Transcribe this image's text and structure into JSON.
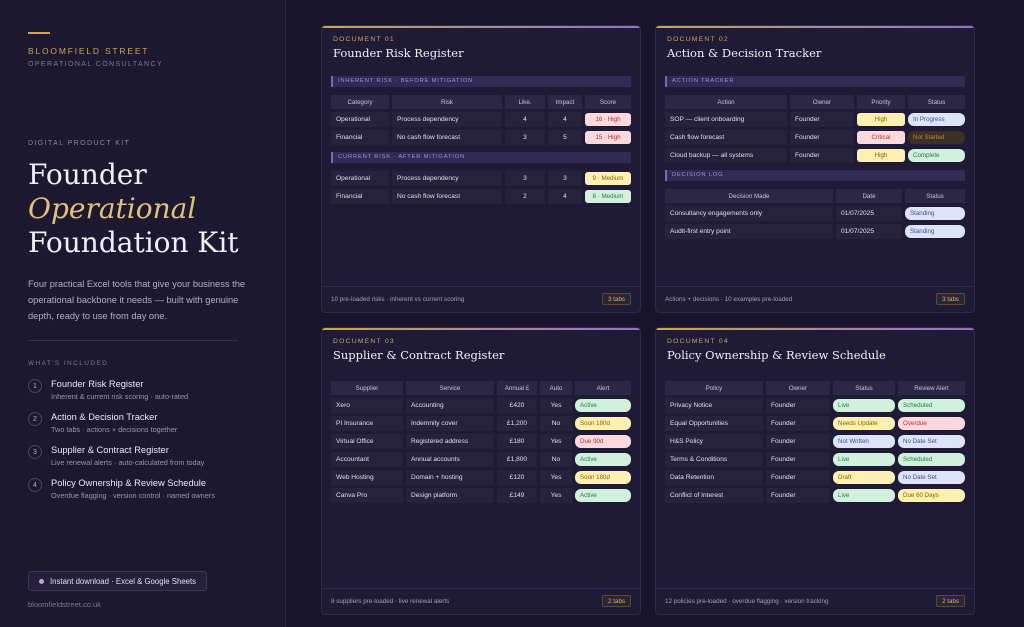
{
  "sidebar": {
    "brand": "BLOOMFIELD STREET",
    "brand_sub": "OPERATIONAL CONSULTANCY",
    "kit_label": "DIGITAL PRODUCT KIT",
    "title_line1": "Founder",
    "title_line2": "Operational",
    "title_line3": "Foundation Kit",
    "description": "Four practical Excel tools that give your business the operational backbone it needs — built with genuine depth, ready to use from day one.",
    "included_label": "WHAT'S INCLUDED",
    "items": [
      {
        "num": "1",
        "title": "Founder Risk Register",
        "sub": "Inherent & current risk scoring · auto-rated"
      },
      {
        "num": "2",
        "title": "Action & Decision Tracker",
        "sub": "Two tabs · actions + decisions together"
      },
      {
        "num": "3",
        "title": "Supplier & Contract Register",
        "sub": "Live renewal alerts · auto-calculated from today"
      },
      {
        "num": "4",
        "title": "Policy Ownership & Review Schedule",
        "sub": "Overdue flagging · version control · named owners"
      }
    ],
    "download_label": "Instant download · Excel & Google Sheets",
    "url": "bloomfieldstreet.co.uk"
  },
  "doc1": {
    "label": "DOCUMENT 01",
    "title": "Founder Risk Register",
    "section1": "INHERENT RISK · BEFORE MITIGATION",
    "section2": "CURRENT RISK · AFTER MITIGATION",
    "headers": [
      "Category",
      "Risk",
      "Like.",
      "Impact",
      "Score"
    ],
    "inherent": [
      {
        "category": "Operational",
        "risk": "Process dependency",
        "like": "4",
        "impact": "4",
        "score": "16 · High"
      },
      {
        "category": "Financial",
        "risk": "No cash flow forecast",
        "like": "3",
        "impact": "5",
        "score": "15 · High"
      }
    ],
    "current": [
      {
        "category": "Operational",
        "risk": "Process dependency",
        "like": "3",
        "impact": "3",
        "score": "9 · Medium"
      },
      {
        "category": "Financial",
        "risk": "No cash flow forecast",
        "like": "2",
        "impact": "4",
        "score": "8 · Medium"
      }
    ],
    "footer": "10 pre-loaded risks · inherent vs current scoring",
    "tabs": "3 tabs"
  },
  "doc2": {
    "label": "DOCUMENT 02",
    "title": "Action & Decision Tracker",
    "section1": "ACTION TRACKER",
    "section2": "DECISION LOG",
    "action_headers": [
      "Action",
      "Owner",
      "Priority",
      "Status"
    ],
    "actions": [
      {
        "action": "SOP — client onboarding",
        "owner": "Founder",
        "priority": "High",
        "status": "In Progress"
      },
      {
        "action": "Cash flow forecast",
        "owner": "Founder",
        "priority": "Critical",
        "status": "Not Started"
      },
      {
        "action": "Cloud backup — all systems",
        "owner": "Founder",
        "priority": "High",
        "status": "Complete"
      }
    ],
    "decision_headers": [
      "Decision Made",
      "Date",
      "Status"
    ],
    "decisions": [
      {
        "decision": "Consultancy engagements only",
        "date": "01/07/2025",
        "status": "Standing"
      },
      {
        "decision": "Audit-first entry point",
        "date": "01/07/2025",
        "status": "Standing"
      }
    ],
    "footer": "Actions + decisions · 10 examples pre-loaded",
    "tabs": "3 tabs"
  },
  "doc3": {
    "label": "DOCUMENT 03",
    "title": "Supplier & Contract Register",
    "headers": [
      "Supplier",
      "Service",
      "Annual £",
      "Auto",
      "Alert"
    ],
    "rows": [
      {
        "supplier": "Xero",
        "service": "Accounting",
        "annual": "£420",
        "auto": "Yes",
        "alert": "Active"
      },
      {
        "supplier": "PI Insurance",
        "service": "Indemnity cover",
        "annual": "£1,200",
        "auto": "No",
        "alert": "Soon 180d"
      },
      {
        "supplier": "Virtual Office",
        "service": "Registered address",
        "annual": "£180",
        "auto": "Yes",
        "alert": "Due 90d"
      },
      {
        "supplier": "Accountant",
        "service": "Annual accounts",
        "annual": "£1,800",
        "auto": "No",
        "alert": "Active"
      },
      {
        "supplier": "Web Hosting",
        "service": "Domain + hosting",
        "annual": "£120",
        "auto": "Yes",
        "alert": "Soon 180d"
      },
      {
        "supplier": "Canva Pro",
        "service": "Design platform",
        "annual": "£149",
        "auto": "Yes",
        "alert": "Active"
      }
    ],
    "footer": "8 suppliers pre-loaded · live renewal alerts",
    "tabs": "2 tabs"
  },
  "doc4": {
    "label": "DOCUMENT 04",
    "title": "Policy Ownership & Review Schedule",
    "headers": [
      "Policy",
      "Owner",
      "Status",
      "Review Alert"
    ],
    "rows": [
      {
        "policy": "Privacy Notice",
        "owner": "Founder",
        "status": "Live",
        "alert": "Scheduled"
      },
      {
        "policy": "Equal Opportunities",
        "owner": "Founder",
        "status": "Needs Update",
        "alert": "Overdue"
      },
      {
        "policy": "H&S Policy",
        "owner": "Founder",
        "status": "Not Written",
        "alert": "No Date Set"
      },
      {
        "policy": "Terms & Conditions",
        "owner": "Founder",
        "status": "Live",
        "alert": "Scheduled"
      },
      {
        "policy": "Data Retention",
        "owner": "Founder",
        "status": "Draft",
        "alert": "No Date Set"
      },
      {
        "policy": "Conflict of Interest",
        "owner": "Founder",
        "status": "Live",
        "alert": "Due 60 Days"
      }
    ],
    "footer": "12 policies pre-loaded · overdue flagging · version tracking",
    "tabs": "2 tabs"
  },
  "colors": {
    "gold": "#c9a45a",
    "pill_red_bg": "#fcd9dc",
    "pill_red_fg": "#b3313c",
    "pill_yellow_bg": "#fdf0b2",
    "pill_yellow_fg": "#8a6200",
    "pill_green_bg": "#d2f1dd",
    "pill_green_fg": "#237a44",
    "pill_blue_bg": "#dde3f8",
    "pill_blue_fg": "#3d4f8f",
    "pill_brown_bg": "#3b3026",
    "pill_brown_fg": "#b58a4c"
  }
}
